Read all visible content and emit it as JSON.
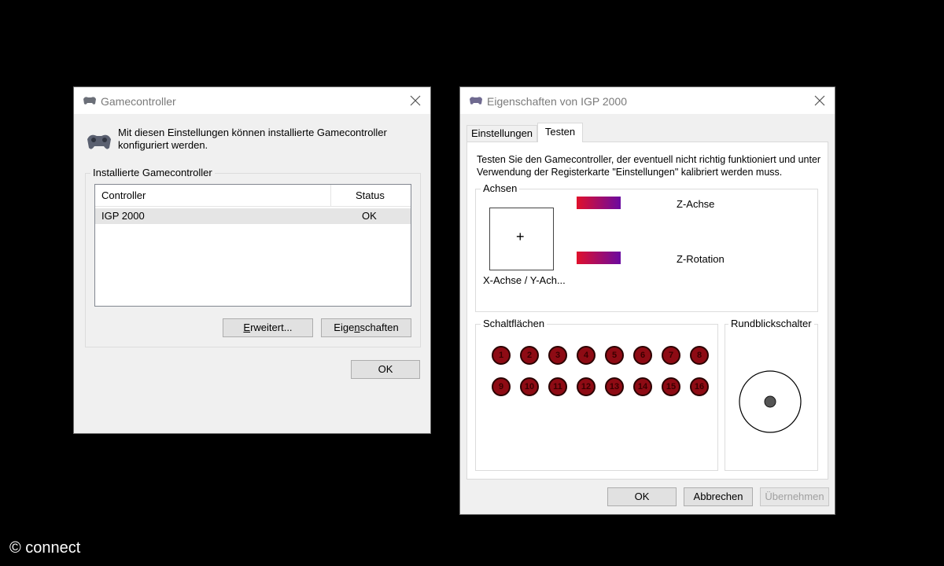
{
  "left_dialog": {
    "title": "Gamecontroller",
    "description": "Mit diesen Einstellungen können installierte Gamecontroller konfiguriert werden.",
    "group_label": "Installierte Gamecontroller",
    "list": {
      "columns": [
        "Controller",
        "Status"
      ],
      "rows": [
        {
          "controller": "IGP 2000",
          "status": "OK"
        }
      ]
    },
    "advanced_button": "Erweitert...",
    "properties_button": "Eigenschaften",
    "ok_button": "OK"
  },
  "right_dialog": {
    "title": "Eigenschaften von IGP 2000",
    "tabs": [
      "Einstellungen",
      "Testen"
    ],
    "active_tab": "Testen",
    "instructions": "Testen Sie den Gamecontroller, der eventuell nicht richtig funktioniert und unter Verwendung der Registerkarte \"Einstellungen\" kalibriert werden muss.",
    "axes": {
      "label": "Achsen",
      "xy_label": "X-Achse / Y-Ach...",
      "xy_crosshair": "+",
      "z_axis": "Z-Achse",
      "z_rotation": "Z-Rotation"
    },
    "buttons_group": {
      "label": "Schaltflächen",
      "numbers": [
        "1",
        "2",
        "3",
        "4",
        "5",
        "6",
        "7",
        "8",
        "9",
        "10",
        "11",
        "12",
        "13",
        "14",
        "15",
        "16"
      ]
    },
    "pov_group": {
      "label": "Rundblickschalter"
    },
    "ok_button": "OK",
    "cancel_button": "Abbrechen",
    "apply_button": "Übernehmen"
  },
  "colors": {
    "bar_start": "#e0102c",
    "bar_end": "#6a0aa0",
    "button_ball": "#8e0b14"
  },
  "watermark": "© connect"
}
